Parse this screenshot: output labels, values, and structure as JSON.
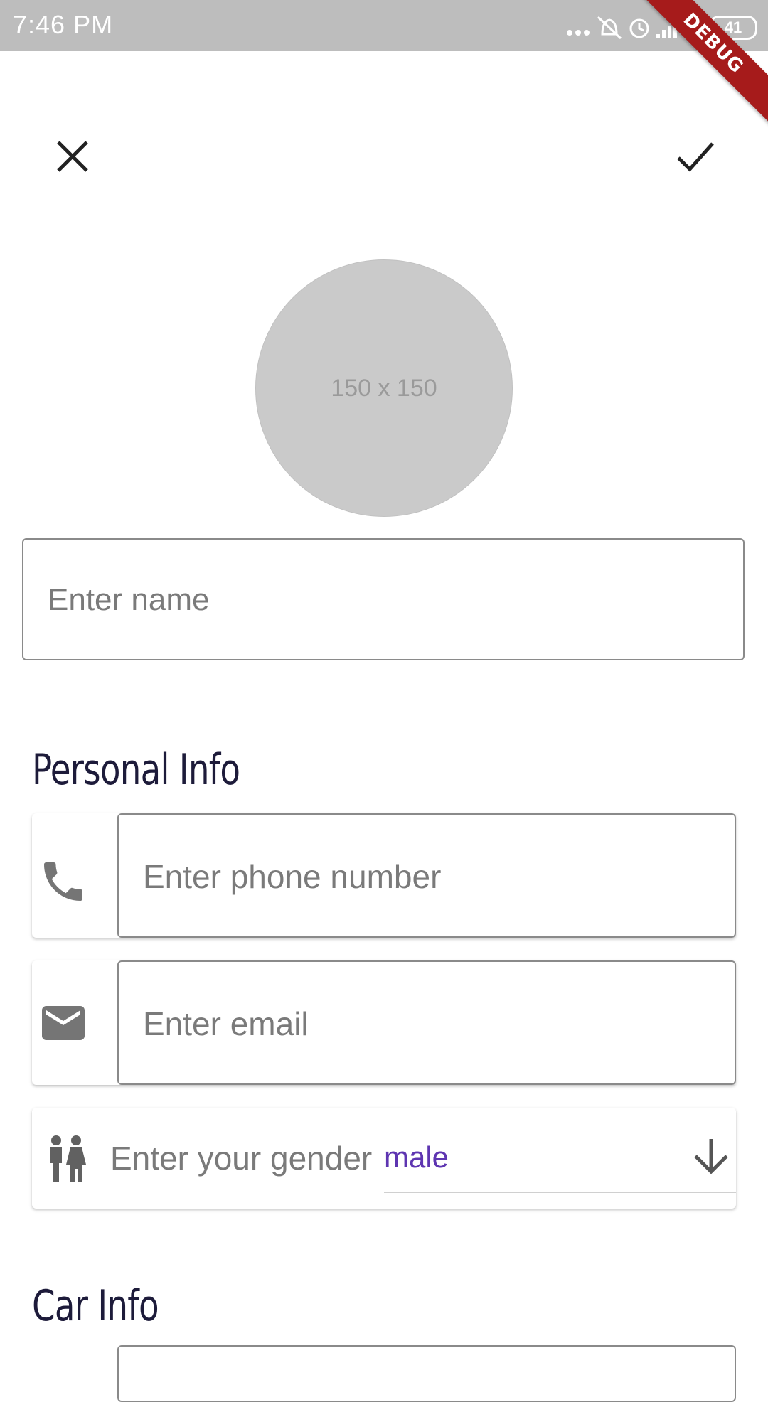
{
  "status_bar": {
    "time": "7:46 PM",
    "battery": "41",
    "icons": [
      "more-dots-icon",
      "mute-icon",
      "alarm-icon",
      "signal-icon",
      "wifi-icon"
    ]
  },
  "debug_banner": "DEBUG",
  "toolbar": {
    "close_icon": "close-icon",
    "confirm_icon": "check-icon"
  },
  "avatar": {
    "placeholder_text": "150 x 150"
  },
  "name_field": {
    "placeholder": "Enter name",
    "value": ""
  },
  "personal_info": {
    "title": "Personal Info",
    "phone": {
      "icon": "phone-icon",
      "placeholder": "Enter phone number",
      "value": ""
    },
    "email": {
      "icon": "email-icon",
      "placeholder": "Enter email",
      "value": ""
    },
    "gender": {
      "icon": "gender-icon",
      "label": "Enter your gender",
      "selected": "male",
      "dropdown_icon": "arrow-down-icon"
    }
  },
  "car_info": {
    "title": "Car Info"
  },
  "colors": {
    "status_bar": "#bdbdbd",
    "accent": "#5e35b1",
    "debug_ribbon": "#a61b1b",
    "heading": "#1d1b3a"
  }
}
